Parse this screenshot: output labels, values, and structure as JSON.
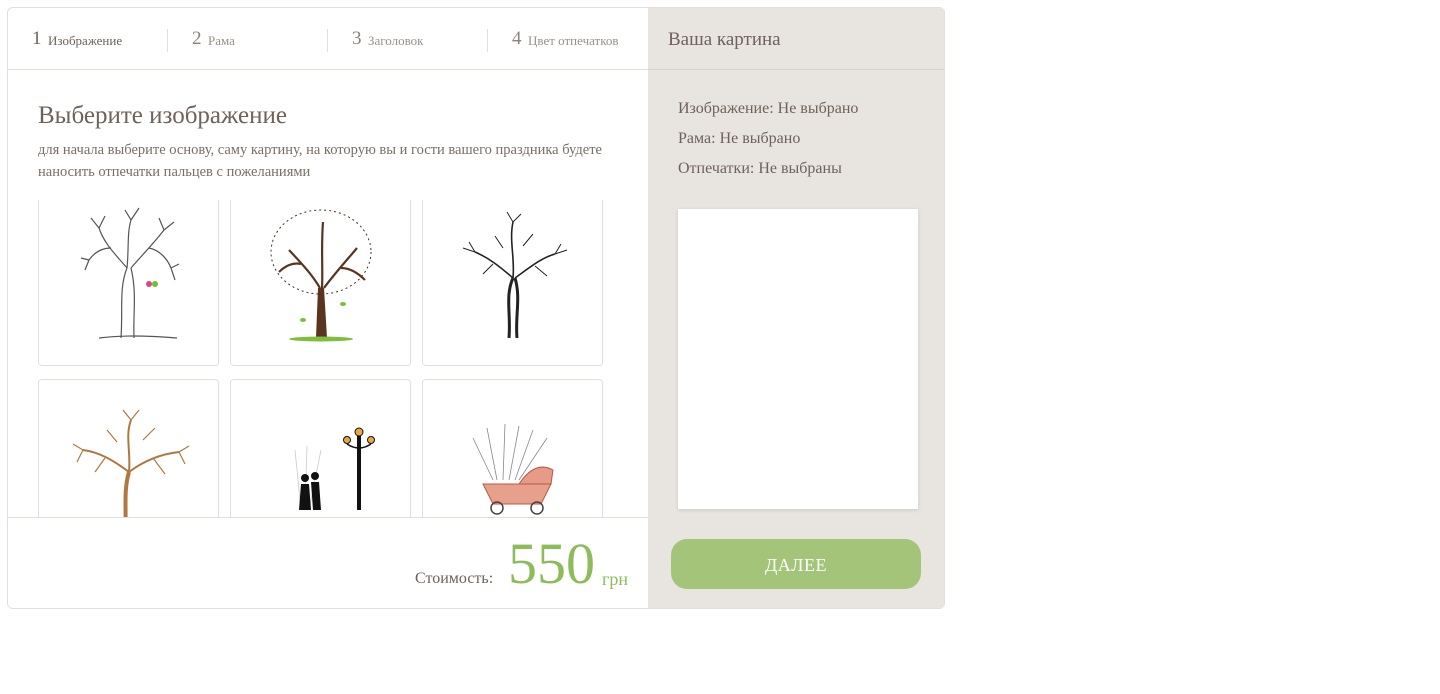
{
  "steps": [
    {
      "num": "1",
      "label": "Изображение"
    },
    {
      "num": "2",
      "label": "Рама"
    },
    {
      "num": "3",
      "label": "Заголовок"
    },
    {
      "num": "4",
      "label": "Цвет отпечатков"
    }
  ],
  "content": {
    "title": "Выберите изображение",
    "description": "для начала выберите основу, саму картину, на которую вы и гости вашего праздника будете наносить отпечатки пальцев с пожеланиями"
  },
  "images": [
    {
      "name": "sketch-tree-birds-icon"
    },
    {
      "name": "brown-tree-icon"
    },
    {
      "name": "black-tree-icon"
    },
    {
      "name": "orange-tree-icon"
    },
    {
      "name": "couple-lamppost-icon"
    },
    {
      "name": "baby-carriage-icon"
    }
  ],
  "footer": {
    "price_label": "Стоимость:",
    "price_value": "550",
    "currency": "грн"
  },
  "summary": {
    "title": "Ваша картина",
    "image_line": "Изображение:  Не выбрано",
    "frame_line": "Рама:  Не выбрано",
    "prints_line": "Отпечатки: Не выбраны"
  },
  "next_button": "ДАЛЕЕ",
  "colors": {
    "accent_green": "#8dbc5a",
    "button_green": "#a4c47a",
    "panel_bg": "#e8e4e0",
    "text": "#6e6259"
  }
}
